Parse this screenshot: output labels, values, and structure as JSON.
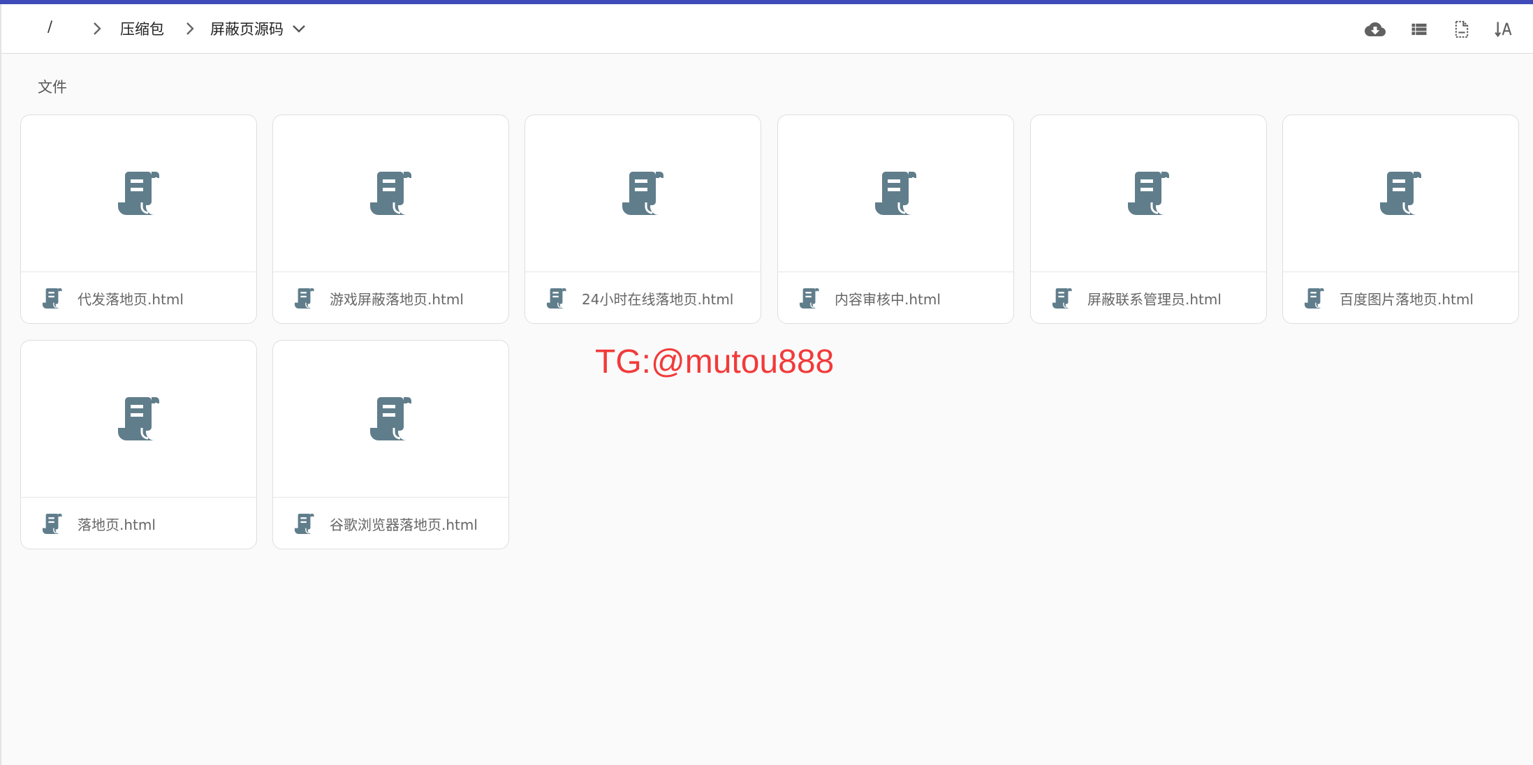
{
  "breadcrumb": {
    "root": "/",
    "items": [
      "压缩包",
      "屏蔽页源码"
    ]
  },
  "toolbar": {
    "icons": [
      "cloud-download-icon",
      "list-view-icon",
      "file-info-icon",
      "sort-icon"
    ],
    "color": "#616161"
  },
  "section": {
    "title": "文件"
  },
  "files": [
    {
      "name": "代发落地页.html"
    },
    {
      "name": "游戏屏蔽落地页.html"
    },
    {
      "name": "24小时在线落地页.html"
    },
    {
      "name": "内容审核中.html"
    },
    {
      "name": "屏蔽联系管理员.html"
    },
    {
      "name": "百度图片落地页.html"
    },
    {
      "name": "落地页.html"
    },
    {
      "name": "谷歌浏览器落地页.html"
    }
  ],
  "file_icon": {
    "name": "script-file-icon",
    "color": "#607d8b"
  },
  "watermark": {
    "text": "TG:@mutou888",
    "color": "#f23a3a"
  },
  "theme": {
    "accent": "#3f4bb8",
    "background": "#fafafa"
  }
}
